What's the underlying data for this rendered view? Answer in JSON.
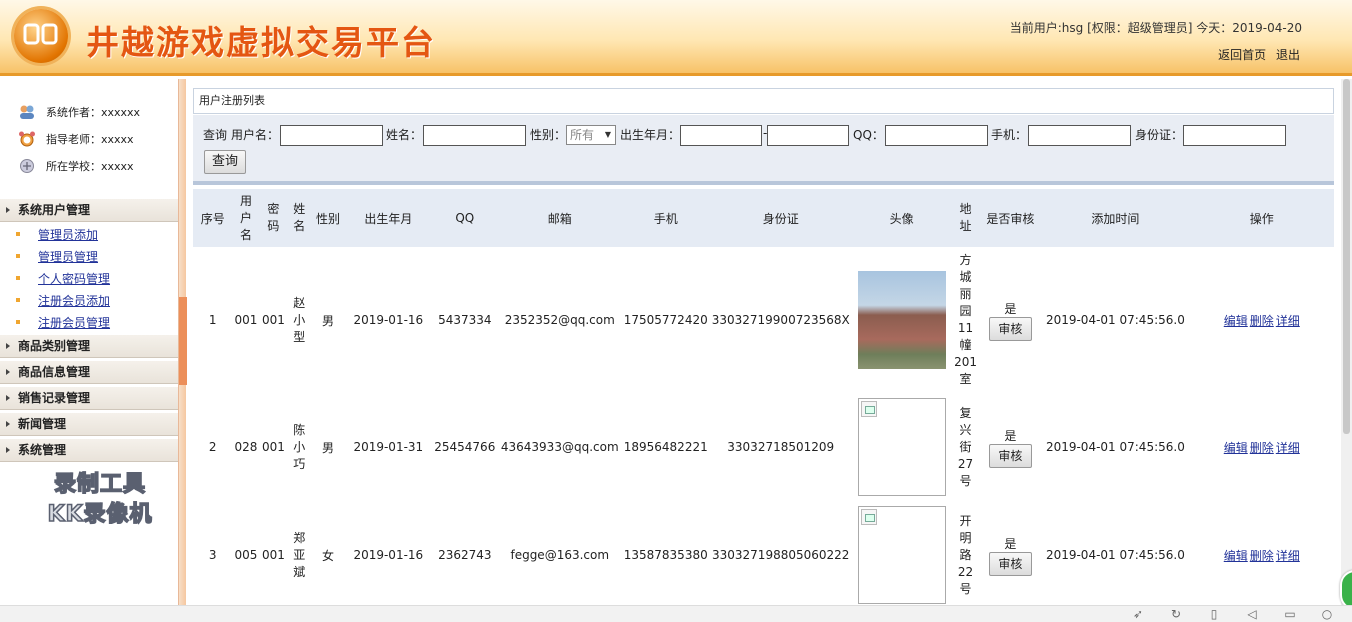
{
  "header": {
    "app_title": "井越游戏虚拟交易平台",
    "user_info": "当前用户:hsg [权限：超级管理员] 今天：2019-04-20",
    "back_home": "返回首页",
    "logout": "退出"
  },
  "sidebar": {
    "author": "系统作者：xxxxxx",
    "teacher": "指导老师：xxxxx",
    "school": "所在学校：xxxxx",
    "groups": [
      {
        "label": "系统用户管理"
      },
      {
        "label": "商品类别管理"
      },
      {
        "label": "商品信息管理"
      },
      {
        "label": "销售记录管理"
      },
      {
        "label": "新闻管理"
      },
      {
        "label": "系统管理"
      }
    ],
    "sub_items": [
      {
        "label": "管理员添加"
      },
      {
        "label": "管理员管理"
      },
      {
        "label": "个人密码管理"
      },
      {
        "label": "注册会员添加"
      },
      {
        "label": "注册会员管理"
      }
    ],
    "watermark_line1": "录制工具",
    "watermark_line2": "KK录像机"
  },
  "panel": {
    "title": "用户注册列表"
  },
  "search": {
    "query_label": "查询",
    "username_label": "用户名：",
    "name_label": "姓名：",
    "gender_label": "性别：",
    "gender_selected": "所有",
    "birth_label": "出生年月：",
    "dash": "-",
    "qq_label": "QQ：",
    "phone_label": "手机：",
    "idcard_label": "身份证：",
    "query_button": "查询"
  },
  "table": {
    "headers": [
      "序号",
      "用户名",
      "密码",
      "姓名",
      "性别",
      "出生年月",
      "QQ",
      "邮箱",
      "手机",
      "身份证",
      "头像",
      "地址",
      "是否审核",
      "添加时间",
      "操作"
    ],
    "review_button": "审核",
    "edit": "编辑",
    "delete": "删除",
    "detail": "详细",
    "rows": [
      {
        "no": "1",
        "username": "001",
        "password": "001",
        "name": "赵小型",
        "gender": "男",
        "birth": "2019-01-16",
        "qq": "5437334",
        "email": "2352352@qq.com",
        "phone": "17505772420",
        "idcard": "33032719900723568X",
        "address": "方城丽园11幢201室",
        "approved": "是",
        "added": "2019-04-01 07:45:56.0"
      },
      {
        "no": "2",
        "username": "028",
        "password": "001",
        "name": "陈小巧",
        "gender": "男",
        "birth": "2019-01-31",
        "qq": "25454766",
        "email": "43643933@qq.com",
        "phone": "18956482221",
        "idcard": "33032718501209",
        "address": "复兴街27号",
        "approved": "是",
        "added": "2019-04-01 07:45:56.0"
      },
      {
        "no": "3",
        "username": "005",
        "password": "001",
        "name": "郑亚斌",
        "gender": "女",
        "birth": "2019-01-16",
        "qq": "2362743",
        "email": "fegge@163.com",
        "phone": "13587835380",
        "idcard": "330327198805060222",
        "address": "开明路22号",
        "approved": "是",
        "added": "2019-04-01 07:45:56.0"
      }
    ]
  }
}
